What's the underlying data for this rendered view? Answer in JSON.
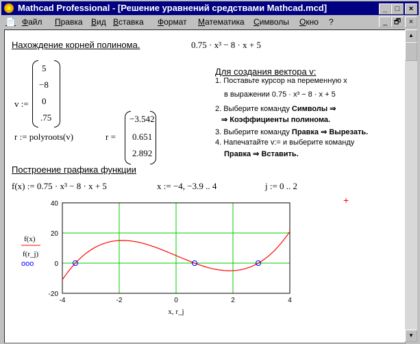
{
  "window": {
    "title": "Mathcad Professional - [Решение уравнений средствами Mathcad.mcd]",
    "min": "_",
    "max": "□",
    "close": "×",
    "restore": "🗗"
  },
  "menu": [
    "Файл",
    "Правка",
    "Вид",
    "Вставка",
    "Формат",
    "Математика",
    "Символы",
    "Окно",
    "?"
  ],
  "doc": {
    "heading1": "Нахождение корней полинома.",
    "poly_expr": "0.75 · x³ − 8 · x + 5",
    "v_label": "v :=",
    "v_values": [
      "5",
      "−8",
      "0",
      ".75"
    ],
    "r_def": "r := polyroots(v)",
    "r_label": "r =",
    "r_values": [
      "−3.542",
      "0.651",
      "2.892"
    ],
    "instr_title": "Для создания вектора v:",
    "instr": [
      "1. Поставьте курсор на переменную x",
      "в выражении 0.75 · x³ − 8 · x + 5",
      "2. Выберите команду ",
      "Символы ⇒",
      "⇒ Коэффициенты полинома.",
      "3. Выберите команду ",
      "Правка ⇒ Вырезать.",
      "4. Напечатайте v:=    и выберите команду",
      "Правка ⇒ Вставить."
    ],
    "heading2": "Построение графика функции",
    "f_def": "f(x) := 0.75 · x³ − 8 · x + 5",
    "x_def": "x := −4, −3.9 .. 4",
    "j_def": "j := 0 .. 2"
  },
  "chart_data": {
    "type": "line",
    "xlabel": "x, r_j",
    "ylabel_1": "f(x)",
    "ylabel_2": "f(r_j)",
    "legend_marker": "ooo",
    "xlim": [
      -4,
      4
    ],
    "ylim": [
      -20,
      40
    ],
    "xticks": [
      "-4",
      "-2",
      "0",
      "2",
      "4"
    ],
    "yticks": [
      "40",
      "20",
      "0",
      "-20"
    ],
    "grid_x": [
      -2,
      0,
      2
    ],
    "grid_y": [
      0,
      20
    ],
    "series": [
      {
        "name": "f(x)",
        "color": "#ff0000",
        "func": "0.75x^3-8x+5",
        "x_step": 0.1
      },
      {
        "name": "f(r_j)",
        "color": "#0000ff",
        "points": [
          [
            -3.542,
            0
          ],
          [
            0.651,
            0
          ],
          [
            2.892,
            0
          ]
        ]
      }
    ],
    "grid_color": "#00cc00"
  }
}
